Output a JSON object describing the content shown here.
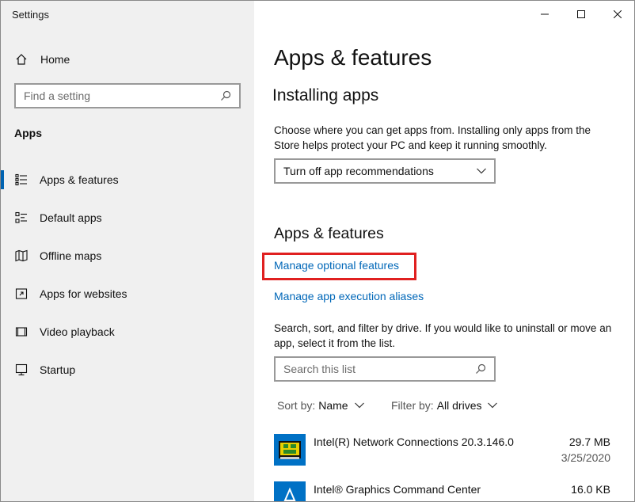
{
  "window": {
    "title": "Settings"
  },
  "sidebar": {
    "home_label": "Home",
    "search_placeholder": "Find a setting",
    "section_label": "Apps",
    "items": [
      {
        "label": "Apps & features",
        "icon": "list-icon",
        "active": true
      },
      {
        "label": "Default apps",
        "icon": "default-apps-icon"
      },
      {
        "label": "Offline maps",
        "icon": "map-icon"
      },
      {
        "label": "Apps for websites",
        "icon": "link-window-icon"
      },
      {
        "label": "Video playback",
        "icon": "video-icon"
      },
      {
        "label": "Startup",
        "icon": "startup-icon"
      }
    ]
  },
  "main": {
    "title": "Apps & features",
    "installing": {
      "heading": "Installing apps",
      "description": "Choose where you can get apps from. Installing only apps from the Store helps protect your PC and keep it running smoothly.",
      "dropdown_value": "Turn off app recommendations"
    },
    "features": {
      "heading": "Apps & features",
      "link_optional": "Manage optional features",
      "link_aliases": "Manage app execution aliases",
      "description": "Search, sort, and filter by drive. If you would like to uninstall or move an app, select it from the list.",
      "search_placeholder": "Search this list",
      "sort_label": "Sort by:",
      "sort_value": "Name",
      "filter_label": "Filter by:",
      "filter_value": "All drives"
    },
    "apps": [
      {
        "name": "Intel(R) Network Connections 20.3.146.0",
        "size": "29.7 MB",
        "date": "3/25/2020"
      },
      {
        "name": "Intel® Graphics Command Center",
        "size": "16.0 KB",
        "date": ""
      }
    ]
  },
  "colors": {
    "accent": "#0063b1",
    "link": "#0067b8",
    "highlight": "#e02020"
  }
}
